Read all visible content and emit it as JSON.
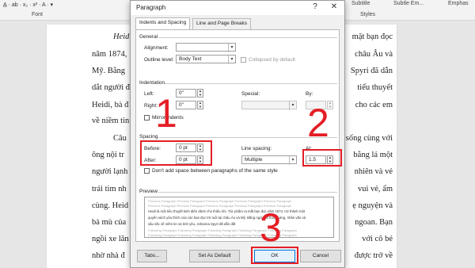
{
  "ribbon": {
    "font_label": "Font",
    "styles_label": "Styles",
    "style_items": [
      "Subtitle",
      "Subtle Em...",
      "Emphas"
    ]
  },
  "document": {
    "left_fragments": [
      {
        "text": "Heid",
        "italic": true
      },
      {
        "text": "năm 1874,"
      },
      {
        "text": "Mỹ. Bằng"
      },
      {
        "text": "dắt người đ"
      },
      {
        "text": "Heidi, bà đ",
        "italic_prefix": "Heidi"
      },
      {
        "text": "về niềm tin"
      },
      {
        "text": "Câu"
      },
      {
        "text": "ông nội tr"
      },
      {
        "text": "người lạnh"
      },
      {
        "text": "trái tim nh"
      },
      {
        "text": "cùng. Heid"
      },
      {
        "text": "bà mù của"
      },
      {
        "text": "ngồi xe lăn"
      },
      {
        "text": "nhờ nhà đ"
      },
      {
        "text": "nhà sống c"
      }
    ],
    "right_fragments": [
      "mặt bạn đọc",
      "châu Âu và",
      "Spyri đã dẫn",
      "tiểu thuyết",
      "cho các em",
      "",
      "sống cùng với",
      "bằng lá một",
      "nhiên và vẻ",
      "vui vẻ, ấm",
      "ẹ nguyện và",
      "ngoan. Bạn",
      "với cô bé",
      "được trở về",
      "ở đàn em"
    ]
  },
  "dialog": {
    "title": "Paragraph",
    "help_label": "?",
    "close_label": "✕",
    "tabs": [
      {
        "label": "Indents and Spacing",
        "active": true
      },
      {
        "label": "Line and Page Breaks",
        "active": false
      }
    ],
    "general": {
      "heading": "General",
      "alignment_label": "Alignment:",
      "alignment_value": "",
      "outline_label": "Outline level:",
      "outline_value": "Body Text",
      "collapsed_label": "Collapsed by default"
    },
    "indentation": {
      "heading": "Indentation",
      "left_label": "Left:",
      "left_value": "0\"",
      "right_label": "Right:",
      "right_value": "0\"",
      "special_label": "Special:",
      "special_value": "",
      "by_label": "By:",
      "by_value": "",
      "mirror_label": "Mirror indents"
    },
    "spacing": {
      "heading": "Spacing",
      "before_label": "Before:",
      "before_value": "0 pt",
      "after_label": "After:",
      "after_value": "0 pt",
      "line_spacing_label": "Line spacing:",
      "line_spacing_value": "Multiple",
      "at_label": "At:",
      "at_value": "1.5",
      "dont_add_label": "Don't add space between paragraphs of the same style"
    },
    "preview": {
      "heading": "Preview",
      "grey_text": "Previous Paragraph Previous Paragraph Previous Paragraph Previous Paragraph Previous Paragraph",
      "sample_lines": [
        "Heidi là một tiểu thuyết kinh điển dành cho thiếu nhi. Tác phẩm ra mắt bạn đọc năm 1874, trở thành một",
        "quyển sách yêu thích của các bạn đọc trẻ tuổi tại châu Âu và Mỹ. Bằng ngòi bút trong sáng, nhân văn và",
        "sâu sắc về niềm tin và tình yêu, Johanna Spyri đã dẫn dắt"
      ],
      "following_text": "Following Paragraph Following Paragraph Following Paragraph Following Paragraph Following Paragraph"
    },
    "buttons": {
      "tabs": "Tabs...",
      "set_default": "Set As Default",
      "ok": "OK",
      "cancel": "Cancel"
    }
  },
  "annotations": {
    "step1": "1",
    "step2": "2",
    "step3": "3",
    "highlight_color": "#e41e25"
  }
}
